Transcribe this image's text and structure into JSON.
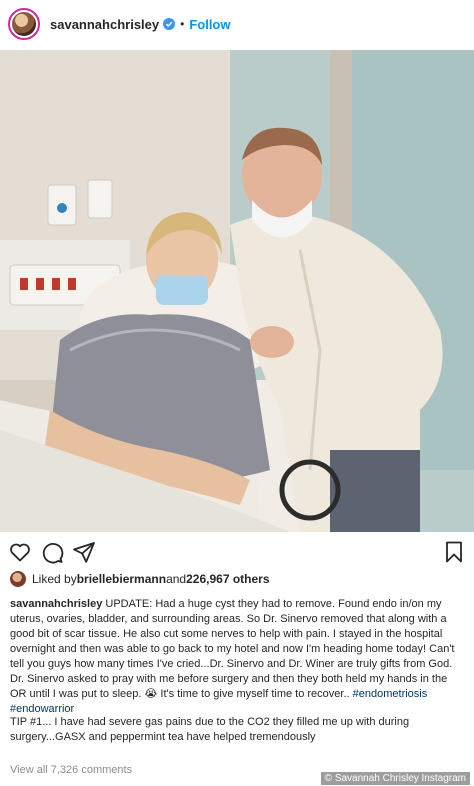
{
  "header": {
    "username": "savannahchrisley",
    "separator": "•",
    "follow_label": "Follow"
  },
  "photo": {
    "description_name": "hospital-photo"
  },
  "actions": {
    "like_icon": "heart-icon",
    "comment_icon": "comment-icon",
    "share_icon": "share-icon",
    "save_icon": "bookmark-icon"
  },
  "likes": {
    "prefix": "Liked by ",
    "user": "briellebiermann",
    "middle": " and ",
    "count": "226,967 others"
  },
  "caption": {
    "username": "savannahchrisley",
    "text": " UPDATE: Had a huge cyst they had to remove. Found endo in/on my uterus, ovaries, bladder, and surrounding areas. So Dr. Sinervo removed that along with a good bit of scar tissue. He also cut some nerves to help with pain. I stayed in the hospital overnight and then was able to go back to my hotel and now I'm heading home today! Can't tell you guys how many times I've cried...Dr. Sinervo and Dr. Winer are truly gifts from God. Dr. Sinervo asked to pray with me before surgery and then they both held my hands in the OR until I was put to sleep. 😭 It's time to give myself time to recover.. ",
    "tag1": "#endometriosis",
    "tag_sep": " ",
    "tag2": "#endowarrior"
  },
  "tip": {
    "text": "TIP #1... I have had severe gas pains due to the CO2 they filled me up with during surgery...GASX and peppermint tea have helped tremendously"
  },
  "comments": {
    "label": "View all 7,326 comments"
  },
  "credit": {
    "text": "© Savannah Chrisley Instagram"
  },
  "colors": {
    "accent": "#0095f6",
    "text": "#262626",
    "muted": "#8e8e8e"
  }
}
